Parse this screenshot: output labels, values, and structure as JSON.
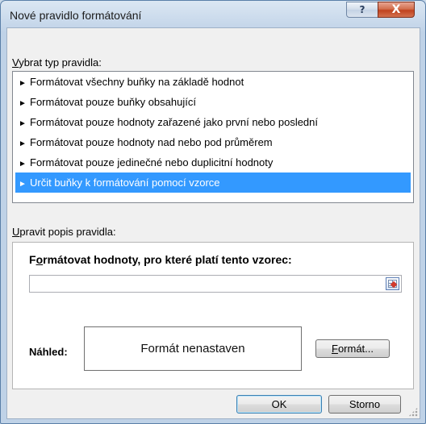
{
  "window": {
    "title": "Nové pravidlo formátování",
    "help_glyph": "?",
    "close_glyph": "X"
  },
  "rule_type": {
    "label_first": "V",
    "label_rest": "ybrat typ pravidla:",
    "items": [
      {
        "label": "Formátovat všechny buňky na základě hodnot"
      },
      {
        "label": "Formátovat pouze buňky obsahující"
      },
      {
        "label": "Formátovat pouze hodnoty zařazené jako první nebo poslední"
      },
      {
        "label": "Formátovat pouze hodnoty nad nebo pod průměrem"
      },
      {
        "label": "Formátovat pouze jedinečné nebo duplicitní hodnoty"
      },
      {
        "label": "Určit buňky k formátování pomocí vzorce",
        "selected": true
      }
    ],
    "arrow_glyph": "►"
  },
  "description": {
    "label_first": "U",
    "label_rest": "pravit popis pravidla:",
    "formula_label_first": "F",
    "formula_label_u": "o",
    "formula_label_rest": "rmátovat hodnoty, pro které platí tento vzorec:",
    "formula_value": "",
    "preview_label": "Náhled:",
    "preview_text": "Formát nenastaven",
    "format_button_first": "F",
    "format_button_rest": "ormát..."
  },
  "buttons": {
    "ok": "OK",
    "cancel": "Storno"
  },
  "colors": {
    "selection": "#3399ff",
    "close_button": "#c0421e"
  }
}
